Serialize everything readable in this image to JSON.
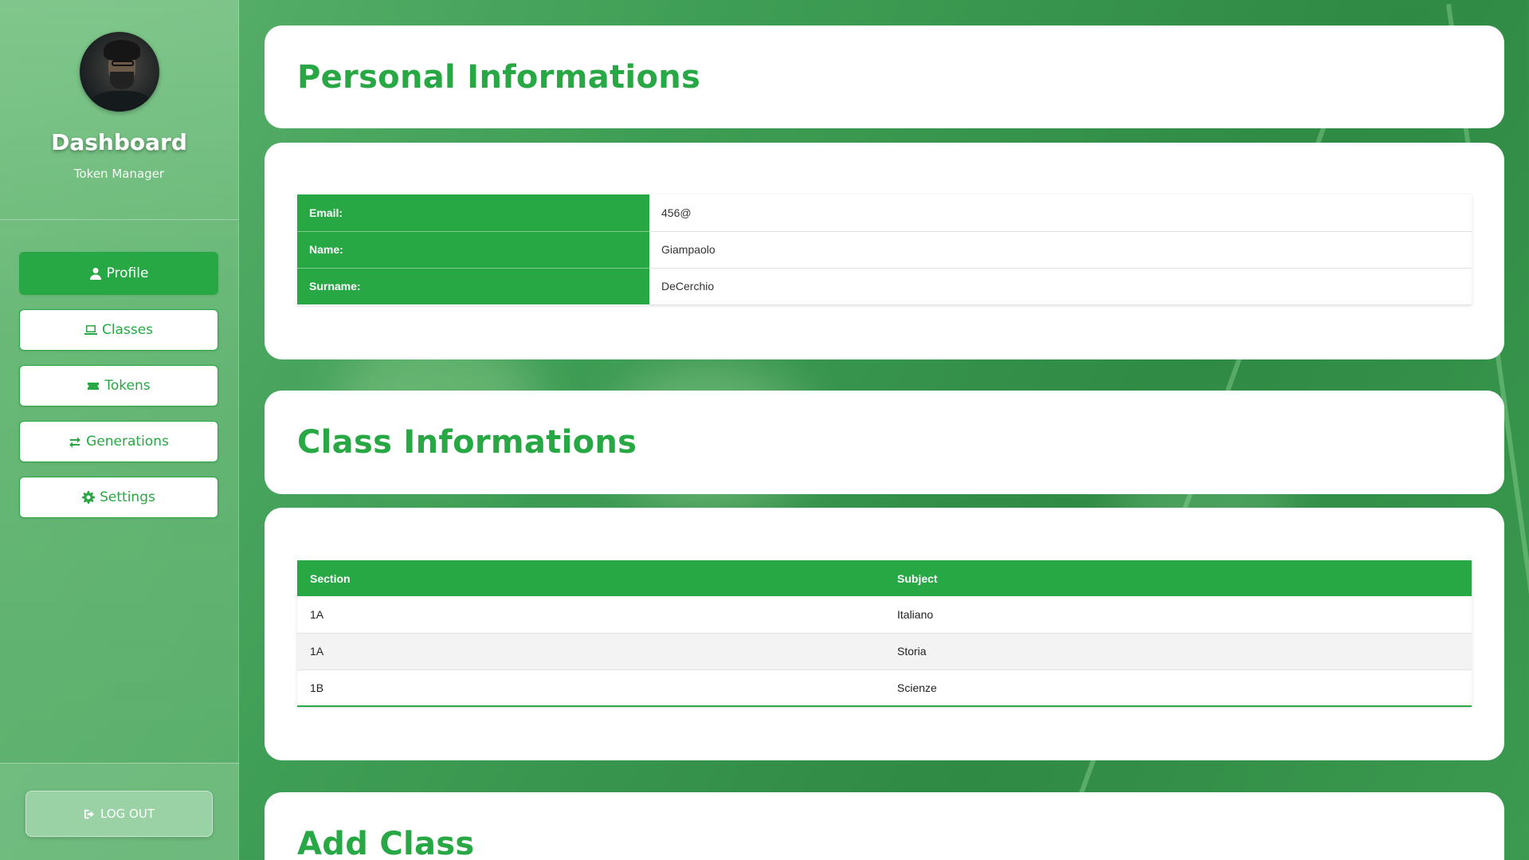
{
  "sidebar": {
    "brand_title": "Dashboard",
    "brand_subtitle": "Token Manager",
    "avatar_icon": "user-photo",
    "nav": [
      {
        "label": "Profile",
        "icon": "user-icon",
        "active": true
      },
      {
        "label": "Classes",
        "icon": "laptop-icon",
        "active": false
      },
      {
        "label": "Tokens",
        "icon": "ticket-icon",
        "active": false
      },
      {
        "label": "Generations",
        "icon": "exchange-icon",
        "active": false
      },
      {
        "label": "Settings",
        "icon": "gear-icon",
        "active": false
      }
    ],
    "logout_label": "LOG OUT"
  },
  "personal": {
    "title": "Personal Informations",
    "rows": [
      {
        "key": "Email:",
        "value": "456@"
      },
      {
        "key": "Name:",
        "value": "Giampaolo"
      },
      {
        "key": "Surname:",
        "value": "DeCerchio"
      }
    ]
  },
  "classes": {
    "title": "Class Informations",
    "headers": [
      "Section",
      "Subject"
    ],
    "rows": [
      [
        "1A",
        "Italiano"
      ],
      [
        "1A",
        "Storia"
      ],
      [
        "1B",
        "Scienze"
      ]
    ]
  },
  "add_class": {
    "title": "Add Class"
  },
  "colors": {
    "accent": "#28a745"
  }
}
